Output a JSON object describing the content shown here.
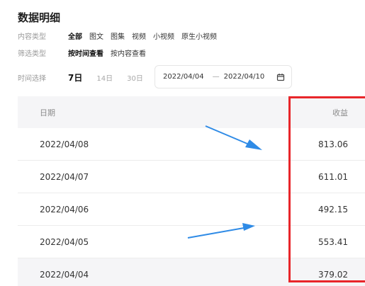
{
  "page": {
    "title": "数据明细"
  },
  "filters": {
    "content_type": {
      "label": "内容类型",
      "options": [
        "全部",
        "图文",
        "图集",
        "视频",
        "小视频",
        "原生小视频"
      ]
    },
    "filter_type": {
      "label": "筛选类型",
      "options": [
        "按时间查看",
        "按内容查看"
      ]
    }
  },
  "time": {
    "label": "时间选择",
    "options": [
      "7日",
      "14日",
      "30日"
    ],
    "selected": "7日",
    "range_start": "2022/04/04",
    "range_sep": "—",
    "range_end": "2022/04/10"
  },
  "table": {
    "headers": {
      "date": "日期",
      "revenue": "收益"
    },
    "rows": [
      {
        "date": "2022/04/08",
        "revenue": "813.06"
      },
      {
        "date": "2022/04/07",
        "revenue": "611.01"
      },
      {
        "date": "2022/04/06",
        "revenue": "492.15"
      },
      {
        "date": "2022/04/05",
        "revenue": "553.41"
      },
      {
        "date": "2022/04/04",
        "revenue": "379.02"
      }
    ]
  },
  "colors": {
    "highlight": "#e8262a",
    "arrow": "#2f8be6",
    "header_bg": "#f5f5f7"
  },
  "icons": {
    "calendar": "calendar-icon"
  }
}
